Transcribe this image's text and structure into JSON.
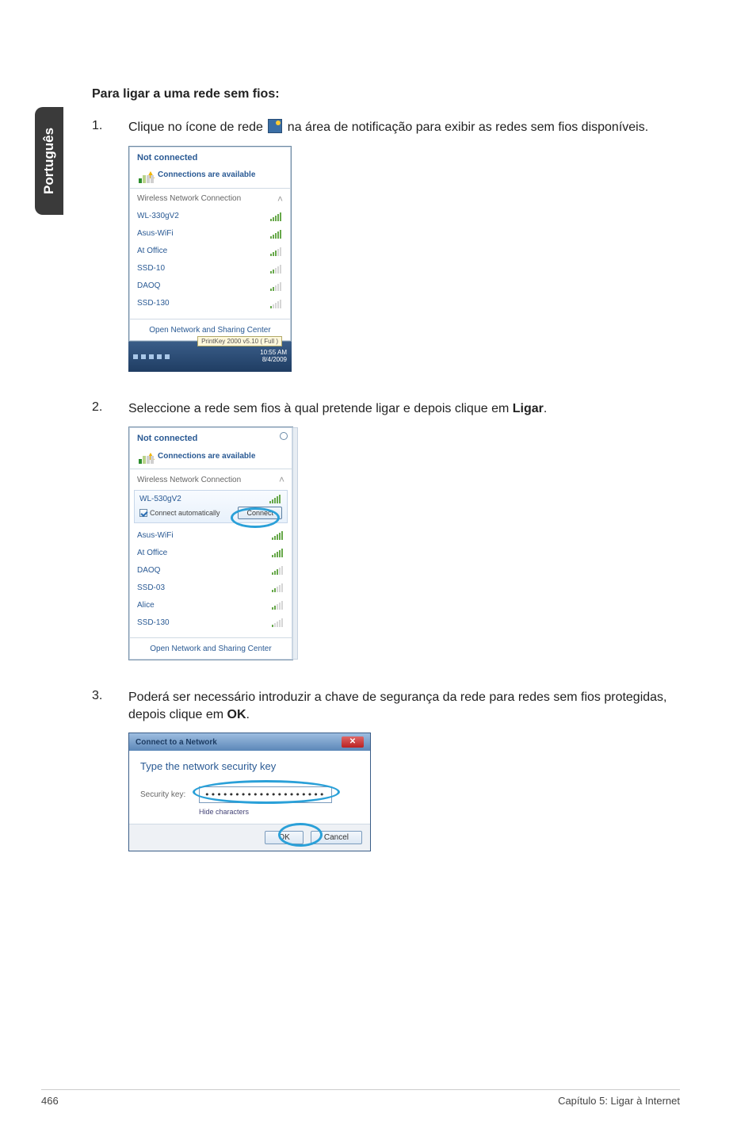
{
  "side_tab": "Português",
  "heading": "Para ligar a uma rede sem fios:",
  "steps": {
    "s1": {
      "num": "1.",
      "t1": "Clique no ícone de rede ",
      "t2": " na área de notificação para exibir as redes sem fios disponíveis."
    },
    "s2": {
      "num": "2.",
      "t1": "Seleccione a rede sem fios à qual pretende ligar e depois clique em ",
      "bold": "Ligar",
      "t2": "."
    },
    "s3": {
      "num": "3.",
      "t1": "Poderá ser necessário introduzir a chave de segurança da rede para redes sem fios protegidas, depois clique em ",
      "bold": "OK",
      "t2": "."
    }
  },
  "popup1": {
    "not_connected": "Not connected",
    "connections_available": "Connections are available",
    "section": "Wireless Network Connection",
    "items": [
      "WL-330gV2",
      "Asus-WiFi",
      "At Office",
      "SSD-10",
      "DAOQ",
      "SSD-130"
    ],
    "open_center": "Open Network and Sharing Center",
    "tooltip": "PrintKey 2000 v5.10 ( Full )",
    "time": "10:55 AM",
    "date": "8/4/2009"
  },
  "popup2": {
    "not_connected": "Not connected",
    "connections_available": "Connections are available",
    "section": "Wireless Network Connection",
    "selected": "WL-530gV2",
    "connect_auto": "Connect automatically",
    "connect_btn": "Connect",
    "items": [
      "Asus-WiFi",
      "At Office",
      "DAOQ",
      "SSD-03",
      "Alice",
      "SSD-130"
    ],
    "open_center": "Open Network and Sharing Center"
  },
  "dialog": {
    "title": "Connect to a Network",
    "instruction": "Type the network security key",
    "sec_label": "Security key:",
    "sec_value": "••••••••••••••••••••",
    "hide": "Hide characters",
    "ok": "OK",
    "cancel": "Cancel"
  },
  "footer": {
    "page": "466",
    "chapter": "Capítulo 5: Ligar à Internet"
  }
}
